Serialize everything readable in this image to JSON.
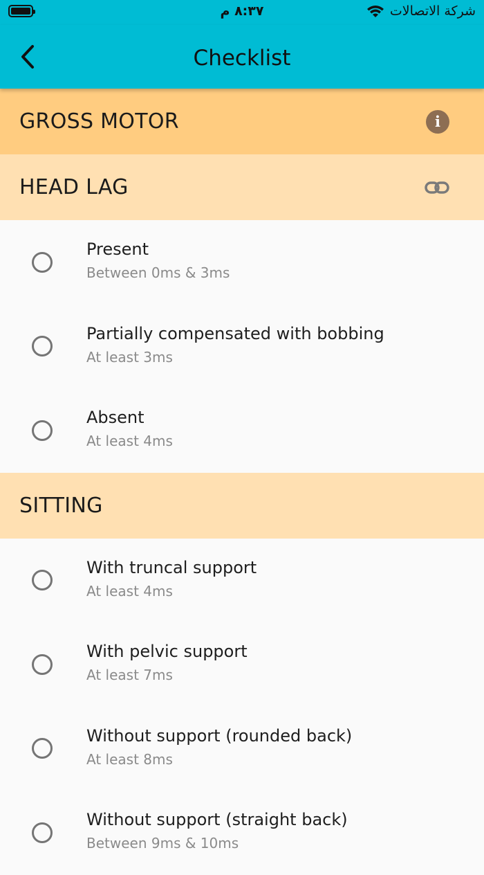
{
  "status_bar": {
    "time": "٨:٣٧ م",
    "carrier": "شركة الاتصالات"
  },
  "app_bar": {
    "title": "Checklist"
  },
  "category": {
    "title": "GROSS MOTOR",
    "info_icon": "i"
  },
  "sections": [
    {
      "title": "HEAD LAG",
      "items": [
        {
          "label": "Present",
          "sub": "Between 0ms & 3ms"
        },
        {
          "label": "Partially compensated with bobbing",
          "sub": "At least 3ms"
        },
        {
          "label": "Absent",
          "sub": "At least 4ms"
        }
      ]
    },
    {
      "title": "SITTING",
      "items": [
        {
          "label": "With truncal support",
          "sub": "At least 4ms"
        },
        {
          "label": "With pelvic support",
          "sub": "At least 7ms"
        },
        {
          "label": "Without support (rounded back)",
          "sub": "At least 8ms"
        },
        {
          "label": "Without support (straight back)",
          "sub": "Between 9ms & 10ms"
        }
      ]
    }
  ],
  "colors": {
    "app_bar": "#00bcd4",
    "category_bg": "#ffcc80",
    "section_bg": "#ffe0b2",
    "list_bg": "#fafafa"
  }
}
